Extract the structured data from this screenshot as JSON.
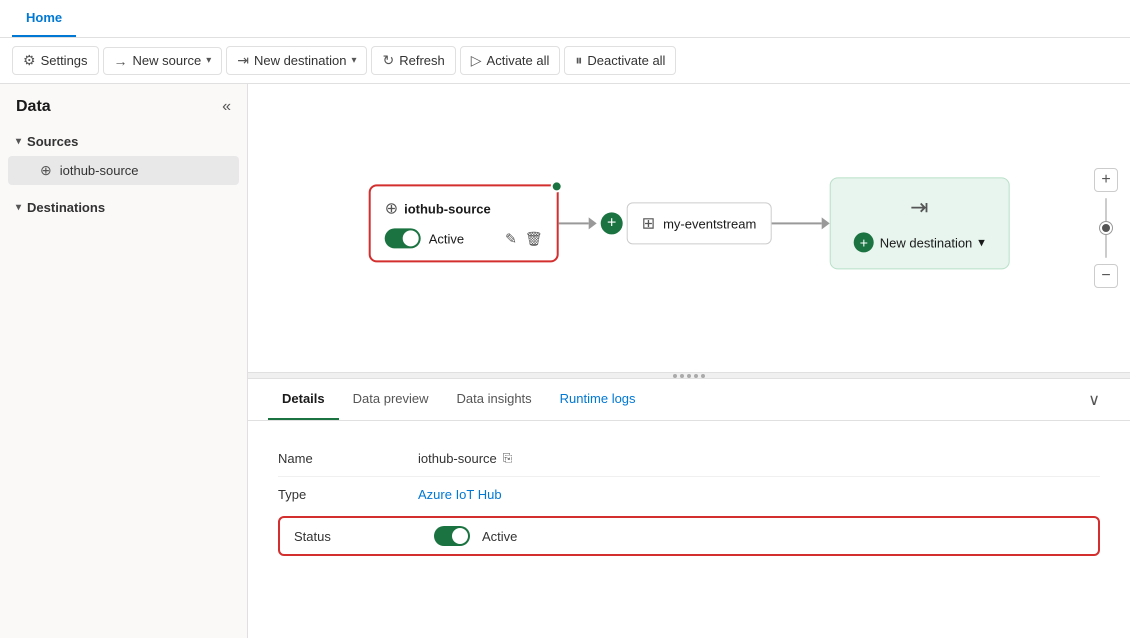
{
  "tab": {
    "home_label": "Home"
  },
  "toolbar": {
    "settings_label": "Settings",
    "new_source_label": "New source",
    "new_destination_label": "New destination",
    "refresh_label": "Refresh",
    "activate_all_label": "Activate all",
    "deactivate_all_label": "Deactivate all"
  },
  "sidebar": {
    "title": "Data",
    "collapse_icon": "«",
    "sources_section": "Sources",
    "sources_item": "iothub-source",
    "destinations_section": "Destinations"
  },
  "canvas": {
    "source_node_name": "iothub-source",
    "source_node_status": "Active",
    "center_node_name": "my-eventstream",
    "dest_new_label": "New destination",
    "zoom_plus": "+",
    "zoom_minus": "−"
  },
  "details": {
    "tab_details": "Details",
    "tab_data_preview": "Data preview",
    "tab_data_insights": "Data insights",
    "tab_runtime_logs": "Runtime logs",
    "name_label": "Name",
    "name_value": "iothub-source",
    "type_label": "Type",
    "type_value": "Azure IoT Hub",
    "status_label": "Status",
    "status_value": "Active"
  }
}
